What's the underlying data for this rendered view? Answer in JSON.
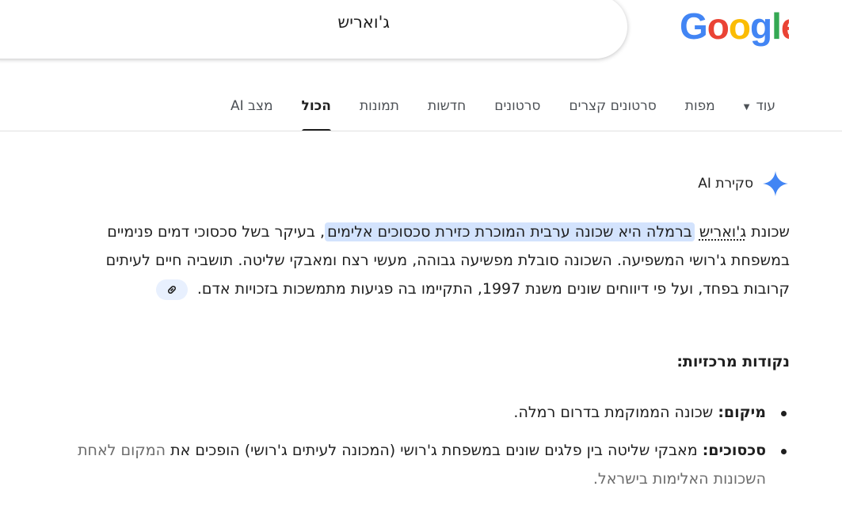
{
  "brand": {
    "logo_text": "Google"
  },
  "search": {
    "query": "ג'ואריש"
  },
  "tabs": [
    {
      "label": "מצב AI"
    },
    {
      "label": "הכול",
      "active": true
    },
    {
      "label": "תמונות"
    },
    {
      "label": "חדשות"
    },
    {
      "label": "סרטונים"
    },
    {
      "label": "סרטונים קצרים"
    },
    {
      "label": "מפות"
    },
    {
      "label": "עוד"
    }
  ],
  "ai_overview": {
    "title": "סקירת AI",
    "para_start": "שכונת ",
    "para_term": "ג'ואריש",
    "para_highlight": "ברמלה היא שכונה ערבית המוכרת כזירת סכסוכים אלימים",
    "para_rest": ", בעיקר בשל סכסוכי דמים פנימיים במשפחת ג'רושי המשפיעה. השכונה סובלת מפשיעה גבוהה, מעשי רצח ומאבקי שליטה. תושביה חיים לעיתים קרובות בפחד, ועל פי דיווחים שונים משנת 1997, התקיימו בה פגיעות מתמשכות בזכויות אדם.",
    "key_points_heading": "נקודות מרכזיות:",
    "bullets": [
      {
        "term": "מיקום:",
        "text": " שכונה הממוקמת בדרום רמלה.",
        "faded": ""
      },
      {
        "term": "סכסוכים:",
        "text": " מאבקי שליטה בין פלגים שונים במשפחת ג'רושי (המכונה לעיתים ג'רושי) הופכים את",
        "faded": " המקום לאחת השכונות האלימות בישראל."
      }
    ]
  },
  "colors": {
    "google_blue": "#4285F4",
    "google_red": "#EA4335",
    "google_yellow": "#FBBC05",
    "google_green": "#34A853",
    "highlight": "#d3e3fd",
    "sparkle": "#4285F4"
  }
}
